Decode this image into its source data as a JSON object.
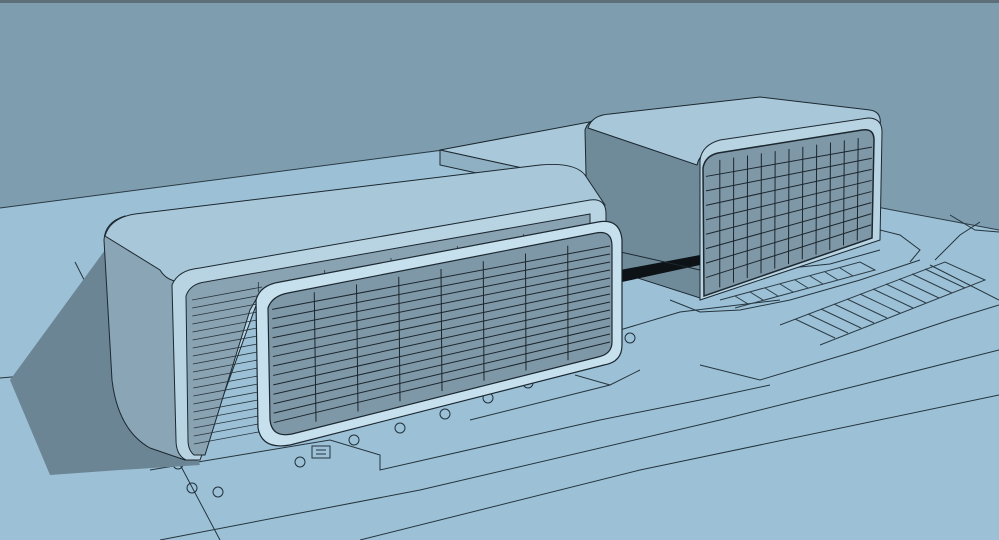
{
  "scene": {
    "colors": {
      "sky": "#7e9eaf",
      "ground": "#9cc1d7",
      "shadow": "#6f8897",
      "wall_light": "#b4d2e2",
      "wall_mid": "#9fbccd",
      "wall_dark": "#6f8a99",
      "roof": "#a8c8da",
      "glass": "#7f98a8",
      "mullion": "#1b262d",
      "line": "#1c2830",
      "frame": "#c6e0ee"
    }
  }
}
